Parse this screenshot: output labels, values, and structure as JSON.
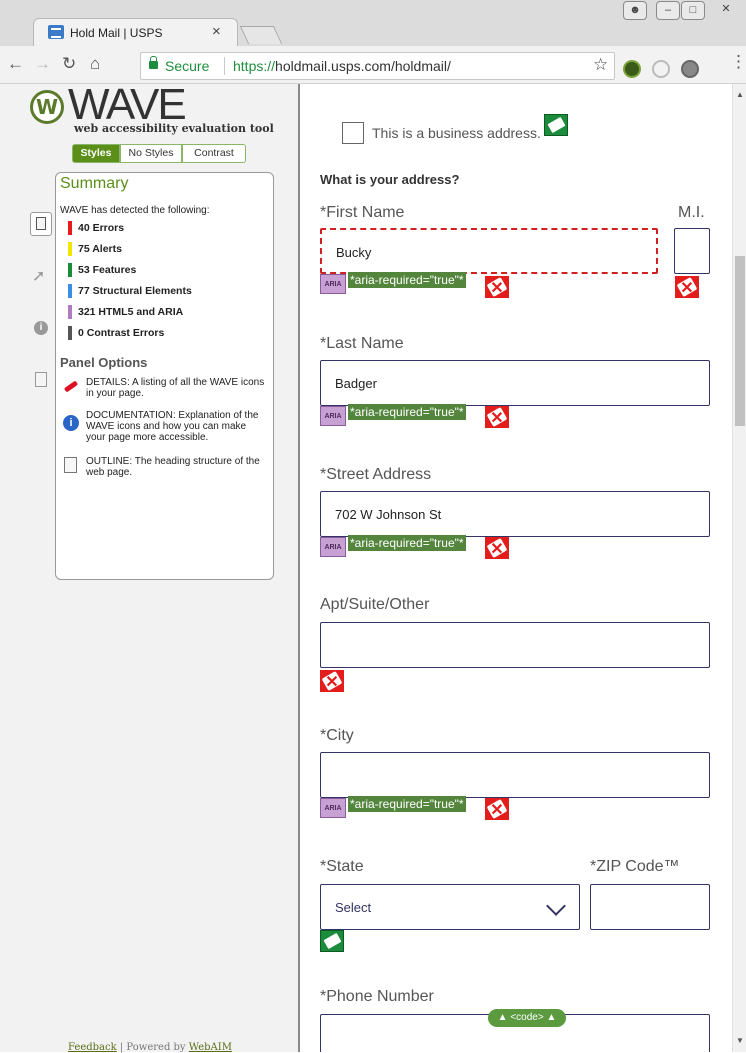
{
  "browser": {
    "tab_title": "Hold Mail | USPS",
    "tab_close": "×",
    "secure_label": "Secure",
    "url_scheme": "https://",
    "url_host": "holdmail.usps.com/holdmail/",
    "url_rest": ""
  },
  "wave": {
    "title": "WAVE",
    "subtitle": "web accessibility evaluation tool",
    "toggles": [
      "Styles",
      "No Styles",
      "Contrast"
    ],
    "summary_title": "Summary",
    "detected_text": "WAVE has detected the following:",
    "stats": [
      {
        "label": "40 Errors",
        "color": "#e31c1c"
      },
      {
        "label": "75 Alerts",
        "color": "#f2e600"
      },
      {
        "label": "53 Features",
        "color": "#1c8c3c"
      },
      {
        "label": "77 Structural Elements",
        "color": "#3a8ee6"
      },
      {
        "label": "321 HTML5 and ARIA",
        "color": "#b07ac4"
      },
      {
        "label": "0 Contrast Errors",
        "color": "#555555"
      }
    ],
    "panel_options_title": "Panel Options",
    "options": [
      {
        "icon": "details-icon",
        "text": "DETAILS: A listing of all the WAVE icons in your page."
      },
      {
        "icon": "info-icon",
        "text": "DOCUMENTATION: Explanation of the WAVE icons and how you can make your page more accessible."
      },
      {
        "icon": "outline-icon",
        "text": "OUTLINE: The heading structure of the web page."
      }
    ],
    "footer_feedback": "Feedback",
    "footer_sep": " | ",
    "footer_powered": "Powered by ",
    "footer_webaim": "WebAIM"
  },
  "form": {
    "business_label": "This is a business address.",
    "question": "What is your address?",
    "first_name_label": "*First Name",
    "first_name_value": "Bucky",
    "mi_label": "M.I.",
    "last_name_label": "*Last Name",
    "last_name_value": "Badger",
    "street_label": "*Street Address",
    "street_value": "702 W Johnson St",
    "apt_label": "Apt/Suite/Other",
    "city_label": "*City",
    "state_label": "*State",
    "state_value": "Select",
    "zip_label": "*ZIP Code™",
    "phone_label": "*Phone Number",
    "aria_text": "*aria-required=\"true\"*",
    "aria_icon_text": "ARIA",
    "code_pill": "▲ <code> ▲"
  }
}
